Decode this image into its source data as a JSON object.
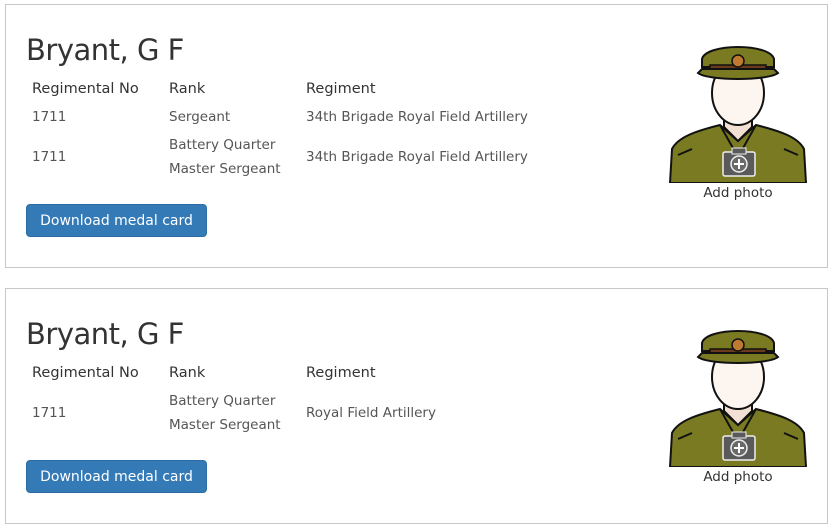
{
  "records": [
    {
      "name": "Bryant, G F",
      "headers": {
        "regimental_no": "Regimental No",
        "rank": "Rank",
        "regiment": "Regiment"
      },
      "rows": [
        {
          "regimental_no": "1711",
          "rank_line1": "Sergeant",
          "rank_line2": "",
          "regiment": "34th Brigade Royal Field Artillery"
        },
        {
          "regimental_no": "1711",
          "rank_line1": "Battery Quarter",
          "rank_line2": "Master Sergeant",
          "regiment": "34th Brigade Royal Field Artillery"
        }
      ],
      "download_label": "Download medal card",
      "add_photo_label": "Add photo"
    },
    {
      "name": "Bryant, G F",
      "headers": {
        "regimental_no": "Regimental No",
        "rank": "Rank",
        "regiment": "Regiment"
      },
      "rows": [
        {
          "regimental_no": "1711",
          "rank_line1": "Battery Quarter",
          "rank_line2": "Master Sergeant",
          "regiment": "Royal Field Artillery"
        }
      ],
      "download_label": "Download medal card",
      "add_photo_label": "Add photo"
    }
  ],
  "colors": {
    "button_bg": "#337ab7",
    "uniform": "#7a7a22",
    "border": "#c8c8c8"
  },
  "icons": {
    "avatar": "soldier-placeholder-icon",
    "camera": "camera-add-icon"
  }
}
